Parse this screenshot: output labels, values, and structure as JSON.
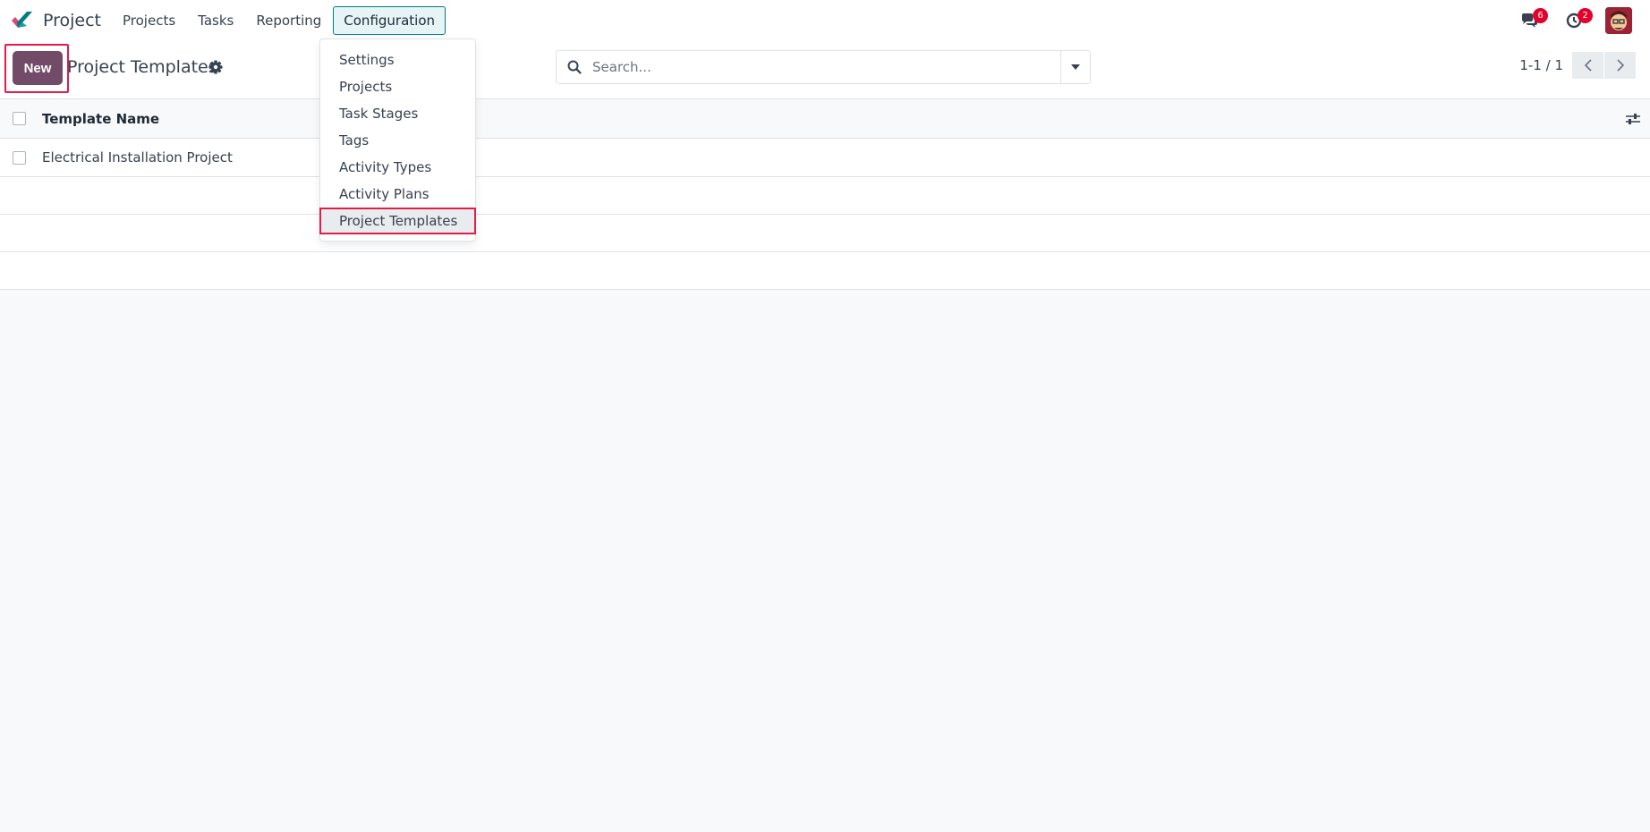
{
  "app": {
    "name": "Project",
    "nav": [
      {
        "label": "Projects"
      },
      {
        "label": "Tasks"
      },
      {
        "label": "Reporting"
      },
      {
        "label": "Configuration",
        "active": true
      }
    ],
    "messages_badge": "6",
    "activities_badge": "2"
  },
  "control_panel": {
    "new_label": "New",
    "title": "Project Templates",
    "search_placeholder": "Search...",
    "pager": "1-1 / 1"
  },
  "list": {
    "columns": [
      "Template Name"
    ],
    "rows": [
      {
        "name": "Electrical Installation Project"
      }
    ]
  },
  "dropdown": {
    "items": [
      {
        "label": "Settings"
      },
      {
        "label": "Projects"
      },
      {
        "label": "Task Stages"
      },
      {
        "label": "Tags"
      },
      {
        "label": "Activity Types"
      },
      {
        "label": "Activity Plans"
      },
      {
        "label": "Project Templates",
        "selected": true
      }
    ]
  },
  "colors": {
    "primary": "#714b67",
    "accent": "#017e84",
    "badge": "#e4002b",
    "highlight": "#e11d48"
  },
  "icons": [
    "project-logo-icon",
    "chat-icon",
    "clock-icon",
    "gear-icon",
    "search-icon",
    "caret-down-icon",
    "chevron-left-icon",
    "chevron-right-icon",
    "sliders-icon"
  ]
}
